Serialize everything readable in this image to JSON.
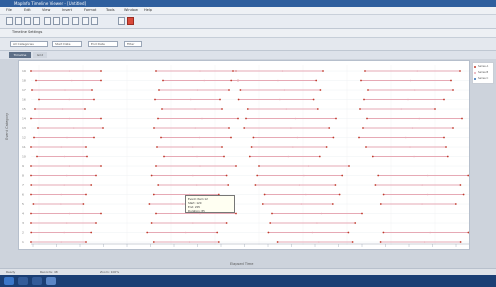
{
  "window": {
    "title": "MapInfo Timeline Viewer - [Untitled]"
  },
  "menu": {
    "items": [
      "File",
      "Edit",
      "View",
      "Insert",
      "Format",
      "Tools",
      "Window",
      "Help",
      "Analysis",
      "Options"
    ]
  },
  "toolbar": {
    "buttons": [
      "New",
      "Open",
      "Save",
      "Print",
      "Cut",
      "Copy",
      "Paste",
      "Undo",
      "Zoom In",
      "Zoom Out",
      "Refresh",
      "Stop"
    ],
    "second_row_label": "Timeline Settings"
  },
  "filters": {
    "fields": [
      "All Categories",
      "Start Date",
      "End Date",
      "Filter",
      "Apply"
    ]
  },
  "tabs": {
    "active": "Timeline",
    "other": "Grid"
  },
  "chart": {
    "ylabel": "Event Category",
    "xlabel": "Elapsed Time",
    "y_ticks": [
      "1",
      "2",
      "3",
      "4",
      "5",
      "6",
      "7",
      "8",
      "9",
      "10",
      "11",
      "12",
      "13",
      "14",
      "15",
      "16",
      "17",
      "18",
      "19"
    ],
    "x_ticks": [
      "0",
      "25",
      "50",
      "75",
      "100",
      "125",
      "150",
      "175",
      "200",
      "225",
      "250",
      "275",
      "300",
      "325",
      "350",
      "375",
      "400",
      "425",
      "450"
    ],
    "legend": [
      "Series A",
      "Series B",
      "Series C"
    ],
    "colors": {
      "bar": "#e6a9b5",
      "marker": "#c0392b",
      "accent": "#2f6fb6"
    },
    "left_labels": [
      "Row 1",
      "Row 2"
    ]
  },
  "tooltip": {
    "lines": [
      "Event: Item 12",
      "Start: 120",
      "End: 205",
      "Duration: 85"
    ]
  },
  "status": {
    "left": "Ready",
    "middle": "Records: 48",
    "right": "Zoom: 100%"
  }
}
